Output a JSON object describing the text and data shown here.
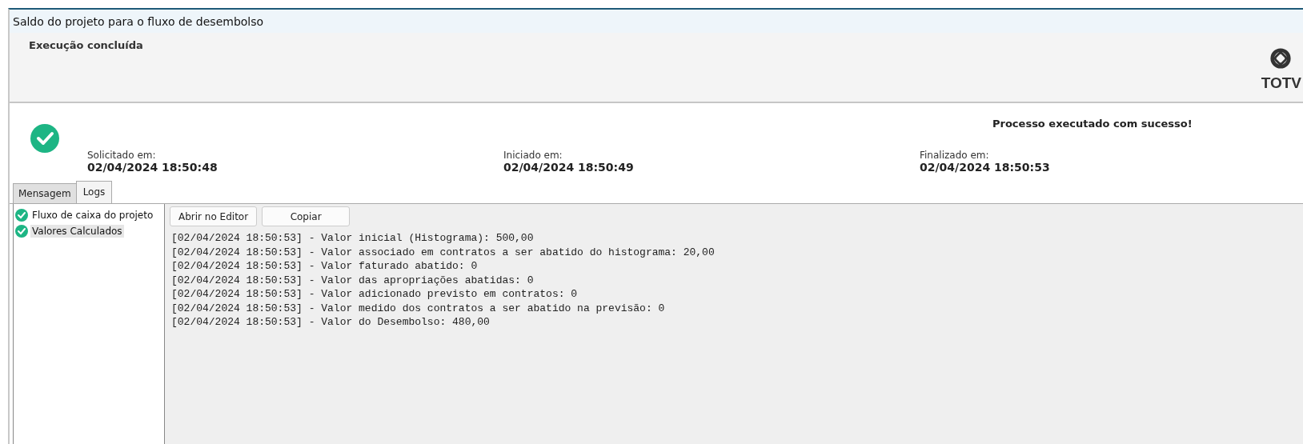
{
  "window": {
    "title": "Saldo do projeto para o fluxo de desembolso"
  },
  "header": {
    "title": "Execução concluída",
    "logo_text": "TOTV"
  },
  "status": {
    "message": "Processo executado com sucesso!",
    "times": [
      {
        "label": "Solicitado em:",
        "value": "02/04/2024 18:50:48"
      },
      {
        "label": "Iniciado em:",
        "value": "02/04/2024 18:50:49"
      },
      {
        "label": "Finalizado em:",
        "value": "02/04/2024 18:50:53"
      }
    ]
  },
  "tabs": [
    {
      "label": "Mensagem",
      "selected": false
    },
    {
      "label": "Logs",
      "selected": true
    }
  ],
  "tree": [
    {
      "label": "Fluxo de caixa do projeto",
      "selected": false
    },
    {
      "label": "Valores Calculados",
      "selected": true
    }
  ],
  "buttons": [
    "Abrir no Editor",
    "Copiar"
  ],
  "log_lines": [
    "[02/04/2024 18:50:53] - Valor inicial (Histograma): 500,00",
    "[02/04/2024 18:50:53] - Valor associado em contratos a ser abatido do histograma: 20,00",
    "[02/04/2024 18:50:53] - Valor faturado abatido: 0",
    "[02/04/2024 18:50:53] - Valor das apropriações abatidas: 0",
    "[02/04/2024 18:50:53] - Valor adicionado previsto em contratos: 0",
    "[02/04/2024 18:50:53] - Valor medido dos contratos a ser abatido na previsão: 0",
    "[02/04/2024 18:50:53] - Valor do Desembolso: 480,00"
  ]
}
